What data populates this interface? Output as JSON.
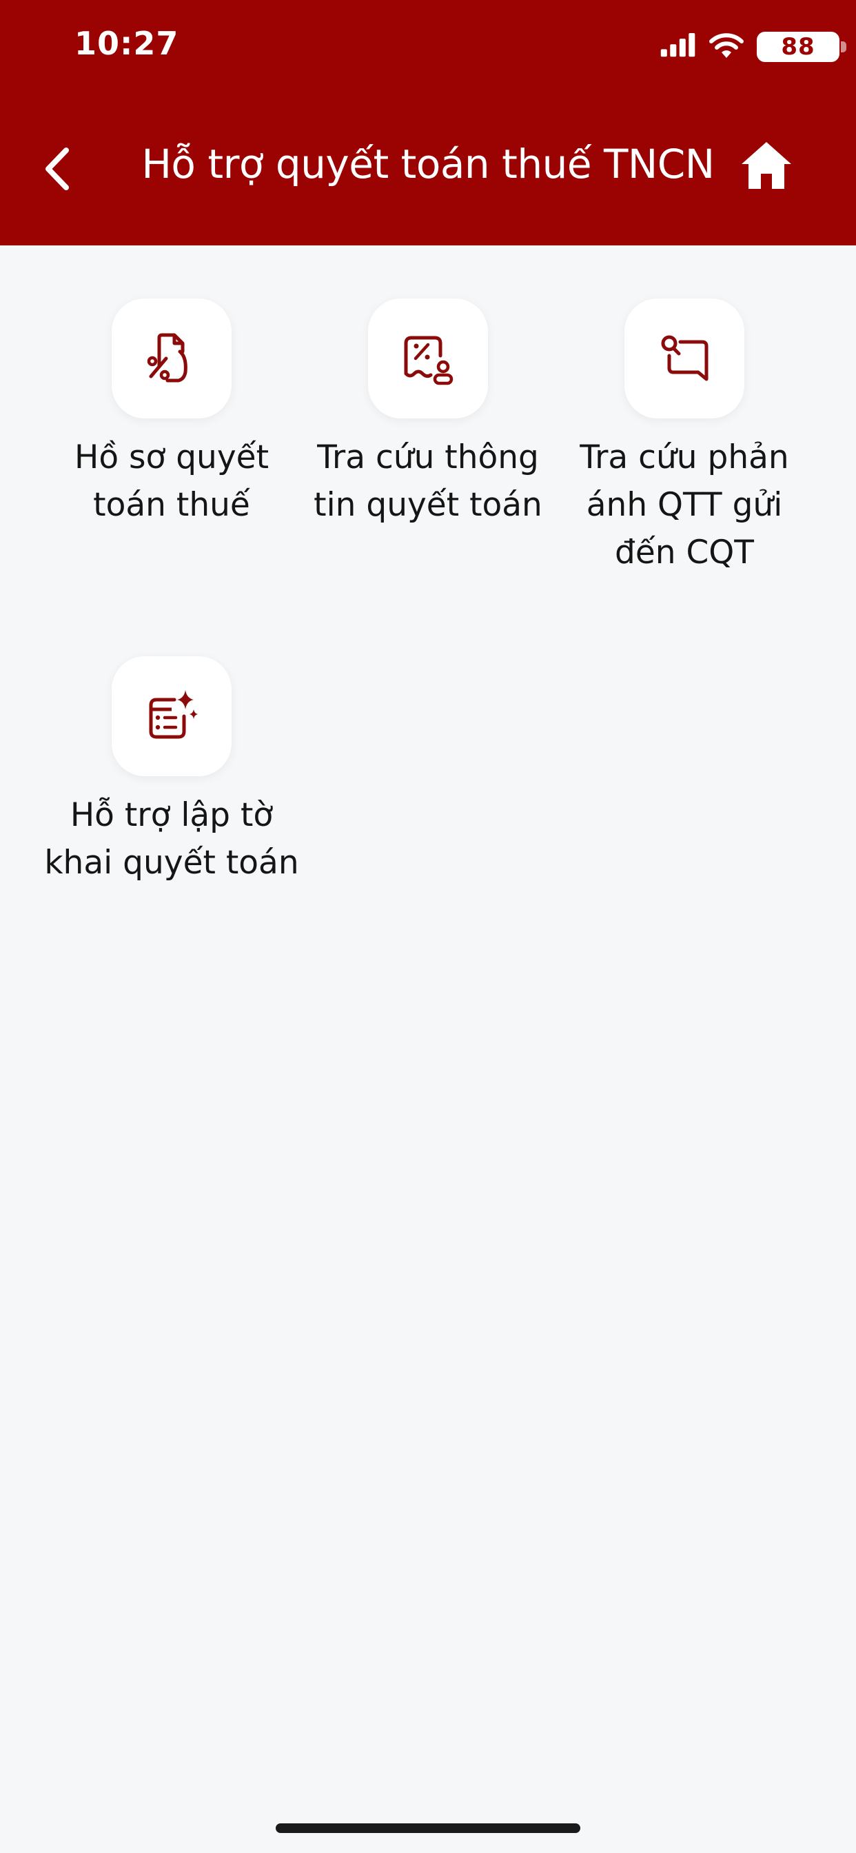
{
  "status_bar": {
    "time": "10:27",
    "battery": "88"
  },
  "header": {
    "title": "Hỗ trợ quyết toán thuế TNCN",
    "back_icon": "chevron-left-icon",
    "home_icon": "home-icon"
  },
  "menu": {
    "items": [
      {
        "label": "Hồ sơ quyết toán thuế",
        "icon": "tax-document-icon"
      },
      {
        "label": "Tra cứu thông tin quyết toán",
        "icon": "tax-lookup-icon"
      },
      {
        "label": "Tra cứu phản ánh QTT gửi đến CQT",
        "icon": "feedback-lookup-icon"
      },
      {
        "label": "Hỗ trợ lập tờ khai quyết toán",
        "icon": "declaration-assist-icon"
      }
    ]
  },
  "colors": {
    "brand": "#9b0303",
    "icon": "#8b0b0b",
    "background": "#f6f7f9"
  }
}
